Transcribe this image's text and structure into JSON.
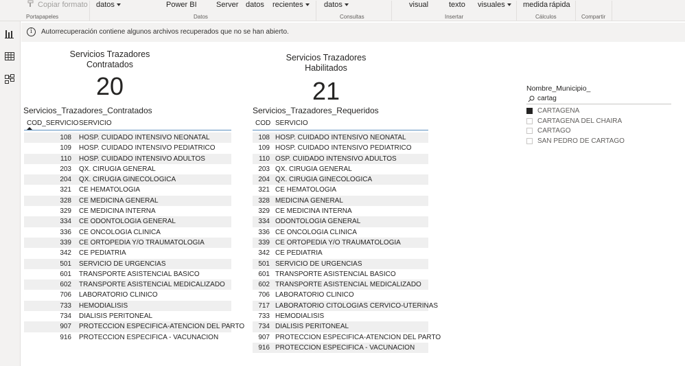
{
  "ribbon": {
    "copy_format": "Copiar formato",
    "datos1": "datos",
    "powerbi": "Power BI",
    "server": "Server",
    "datos2": "datos",
    "recientes": "recientes",
    "datos3": "datos",
    "visual": "visual",
    "texto": "texto",
    "visuales": "visuales",
    "medida": "medida",
    "rapida": "rápida",
    "groups": {
      "portapapeles": "Portapapeles",
      "datos": "Datos",
      "consultas": "Consultas",
      "insertar": "Insertar",
      "calculos": "Cálculos",
      "compartir": "Compartir"
    }
  },
  "rail": {
    "icons": [
      "report-view-icon",
      "data-view-icon",
      "model-view-icon"
    ]
  },
  "infobar": {
    "message": "Autorrecuperación contiene algunos archivos recuperados que no se han abierto."
  },
  "card1": {
    "title": "Servicios Trazadores\nContratados",
    "value": "20"
  },
  "card2": {
    "title": "Servicios Trazadores\nHabilitados",
    "value": "21"
  },
  "table1": {
    "title": "Servicios_Trazadores_Contratados",
    "col_code": "COD_SERVICIO",
    "col_service": "SERVICIO",
    "rows": [
      [
        "108",
        "HOSP. CUIDADO INTENSIVO NEONATAL"
      ],
      [
        "109",
        "HOSP. CUIDADO INTENSIVO PEDIATRICO"
      ],
      [
        "110",
        "HOSP. CUIDADO INTENSIVO ADULTOS"
      ],
      [
        "203",
        "QX. CIRUGIA GENERAL"
      ],
      [
        "204",
        "QX. CIRUGIA GINECOLOGICA"
      ],
      [
        "321",
        "CE HEMATOLOGIA"
      ],
      [
        "328",
        "CE MEDICINA GENERAL"
      ],
      [
        "329",
        "CE MEDICINA INTERNA"
      ],
      [
        "334",
        "CE ODONTOLOGIA GENERAL"
      ],
      [
        "336",
        "CE ONCOLOGIA CLINICA"
      ],
      [
        "339",
        "CE ORTOPEDIA Y/O TRAUMATOLOGIA"
      ],
      [
        "342",
        "CE PEDIATRIA"
      ],
      [
        "501",
        "SERVICIO DE URGENCIAS"
      ],
      [
        "601",
        "TRANSPORTE ASISTENCIAL BASICO"
      ],
      [
        "602",
        "TRANSPORTE ASISTENCIAL MEDICALIZADO"
      ],
      [
        "706",
        "LABORATORIO CLINICO"
      ],
      [
        "733",
        "HEMODIALISIS"
      ],
      [
        "734",
        "DIALISIS PERITONEAL"
      ],
      [
        "907",
        "PROTECCION ESPECIFICA-ATENCION DEL PARTO"
      ],
      [
        "916",
        "PROTECCION ESPECIFICA - VACUNACION"
      ]
    ]
  },
  "table2": {
    "title": "Servicios_Trazadores_Requeridos",
    "col_code": "COD",
    "col_service": "SERVICIO",
    "rows": [
      [
        "108",
        "HOSP. CUIDADO INTENSIVO NEONATAL"
      ],
      [
        "109",
        "HOSP. CUIDADO INTENSIVO PEDIATRICO"
      ],
      [
        "110",
        "OSP. CUIDADO INTENSIVO ADULTOS"
      ],
      [
        "203",
        "QX. CIRUGIA GENERAL"
      ],
      [
        "204",
        "QX. CIRUGIA GINECOLOGICA"
      ],
      [
        "321",
        "CE HEMATOLOGIA"
      ],
      [
        "328",
        "MEDICINA GENERAL"
      ],
      [
        "329",
        "CE MEDICINA INTERNA"
      ],
      [
        "334",
        "ODONTOLOGIA GENERAL"
      ],
      [
        "336",
        "CE ONCOLOGIA CLINICA"
      ],
      [
        "339",
        "CE ORTOPEDIA Y/O TRAUMATOLOGIA"
      ],
      [
        "342",
        "CE PEDIATRIA"
      ],
      [
        "501",
        "SERVICIO DE URGENCIAS"
      ],
      [
        "601",
        "TRANSPORTE ASISTENCIAL BASICO"
      ],
      [
        "602",
        "TRANSPORTE ASISTENCIAL MEDICALIZADO"
      ],
      [
        "706",
        "LABORATORIO CLINICO"
      ],
      [
        "717",
        "LABORATORIO CITOLOGIAS CERVICO-UTERINAS"
      ],
      [
        "733",
        "HEMODIALISIS"
      ],
      [
        "734",
        "DIALISIS PERITONEAL"
      ],
      [
        "907",
        "PROTECCION ESPECIFICA-ATENCION DEL PARTO"
      ],
      [
        "916",
        "PROTECCION ESPECIFICA - VACUNACION"
      ]
    ]
  },
  "slicer": {
    "title": "Nombre_Municipio_",
    "search_value": "cartag",
    "items": [
      {
        "label": "CARTAGENA",
        "checked": true
      },
      {
        "label": "CARTAGENA DEL CHAIRA",
        "checked": false
      },
      {
        "label": "CARTAGO",
        "checked": false
      },
      {
        "label": "SAN PEDRO DE CARTAGO",
        "checked": false
      }
    ]
  }
}
